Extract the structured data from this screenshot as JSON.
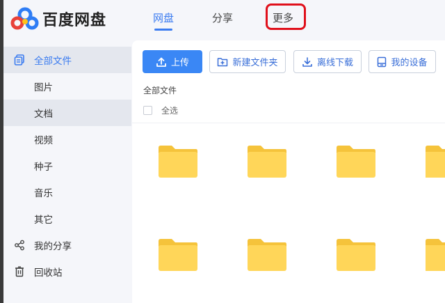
{
  "app": {
    "logo_text": "百度网盘"
  },
  "nav": {
    "tabs": [
      {
        "label": "网盘",
        "active": true
      },
      {
        "label": "分享",
        "active": false
      },
      {
        "label": "更多",
        "active": false,
        "highlighted": true
      }
    ]
  },
  "sidebar": {
    "items": [
      {
        "label": "全部文件",
        "icon": "all-files-icon"
      },
      {
        "label": "图片"
      },
      {
        "label": "文档"
      },
      {
        "label": "视频"
      },
      {
        "label": "种子"
      },
      {
        "label": "音乐"
      },
      {
        "label": "其它"
      },
      {
        "label": "我的分享",
        "icon": "share-icon"
      },
      {
        "label": "回收站",
        "icon": "recycle-bin-icon"
      }
    ]
  },
  "toolbar": {
    "upload_label": "上传",
    "new_folder_label": "新建文件夹",
    "offline_download_label": "离线下载",
    "my_devices_label": "我的设备"
  },
  "breadcrumb": "全部文件",
  "select_all_label": "全选",
  "colors": {
    "accent": "#3a7bf0",
    "folder": "#ffd659",
    "folder_tab": "#f5c33b",
    "highlight_box": "#e0101b"
  }
}
